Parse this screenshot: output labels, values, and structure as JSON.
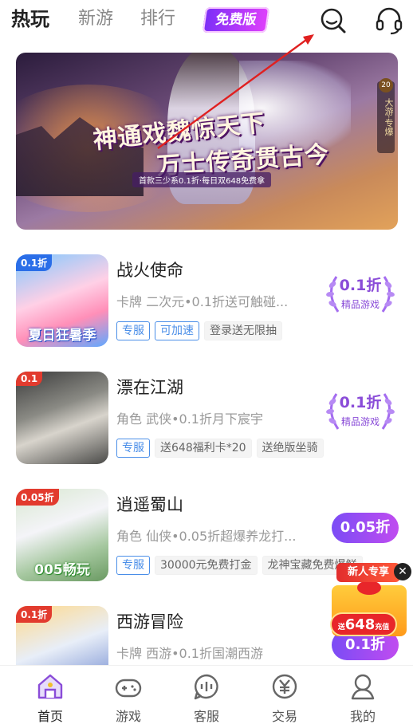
{
  "top_tabs": {
    "items": [
      "热玩",
      "新游",
      "排行"
    ],
    "active": "热玩",
    "free_badge": "免费版"
  },
  "icons": {
    "search": "search-icon",
    "support": "headset-icon"
  },
  "banner": {
    "headline_1": "神通戏魏惊天下",
    "headline_2": "万士传奇贯古今",
    "subline": "首款三少系0.1折·每日双648免费拿",
    "side_badge": "20",
    "side_text": "大游·专爆"
  },
  "games": [
    {
      "name": "战火使命",
      "desc": "卡牌 二次元•0.1折送可触碰...",
      "tags_blue": [
        "专服",
        "可加速"
      ],
      "tags_gray": [
        "登录送无限抽"
      ],
      "thumb_corner": "0.1折",
      "thumb_caption": "夏日狂暑季",
      "discount": "0.1折",
      "discount_sub": "精品游戏",
      "badge_style": "laurel"
    },
    {
      "name": "漂在江湖",
      "desc": "角色 武侠•0.1折月下宸宇",
      "tags_blue": [
        "专服"
      ],
      "tags_gray": [
        "送648福利卡*20",
        "送绝版坐骑"
      ],
      "thumb_corner": "0.1",
      "thumb_caption": "",
      "discount": "0.1折",
      "discount_sub": "精品游戏",
      "badge_style": "laurel"
    },
    {
      "name": "逍遥蜀山",
      "desc": "角色 仙侠•0.05折超爆养龙打...",
      "tags_blue": [
        "专服"
      ],
      "tags_gray": [
        "30000元免费打金",
        "龙神宝藏免费爆鲜"
      ],
      "thumb_corner": "0.05折",
      "thumb_caption": "005畅玩",
      "discount": "0.05折",
      "discount_sub": "",
      "badge_style": "pill"
    },
    {
      "name": "西游冒险",
      "desc": "卡牌 西游•0.1折国潮西游",
      "tags_blue": [],
      "tags_gray": [],
      "thumb_corner": "0.1折",
      "thumb_caption": "",
      "discount": "0.1折",
      "discount_sub": "",
      "badge_style": "pill"
    }
  ],
  "promo": {
    "ribbon": "新人专享",
    "value": "648",
    "value_prefix": "送",
    "value_suffix": "充值"
  },
  "bottom_nav": {
    "items": [
      {
        "label": "首页",
        "icon": "home-icon"
      },
      {
        "label": "游戏",
        "icon": "gamepad-icon"
      },
      {
        "label": "客服",
        "icon": "chat-icon"
      },
      {
        "label": "交易",
        "icon": "yuan-icon"
      },
      {
        "label": "我的",
        "icon": "profile-icon"
      }
    ],
    "active": "首页"
  },
  "colors": {
    "accent_purple": "#8a4cd8",
    "tag_blue": "#4a8ee8",
    "arrow_red": "#e02020",
    "home_active": "#8a4cd8"
  }
}
